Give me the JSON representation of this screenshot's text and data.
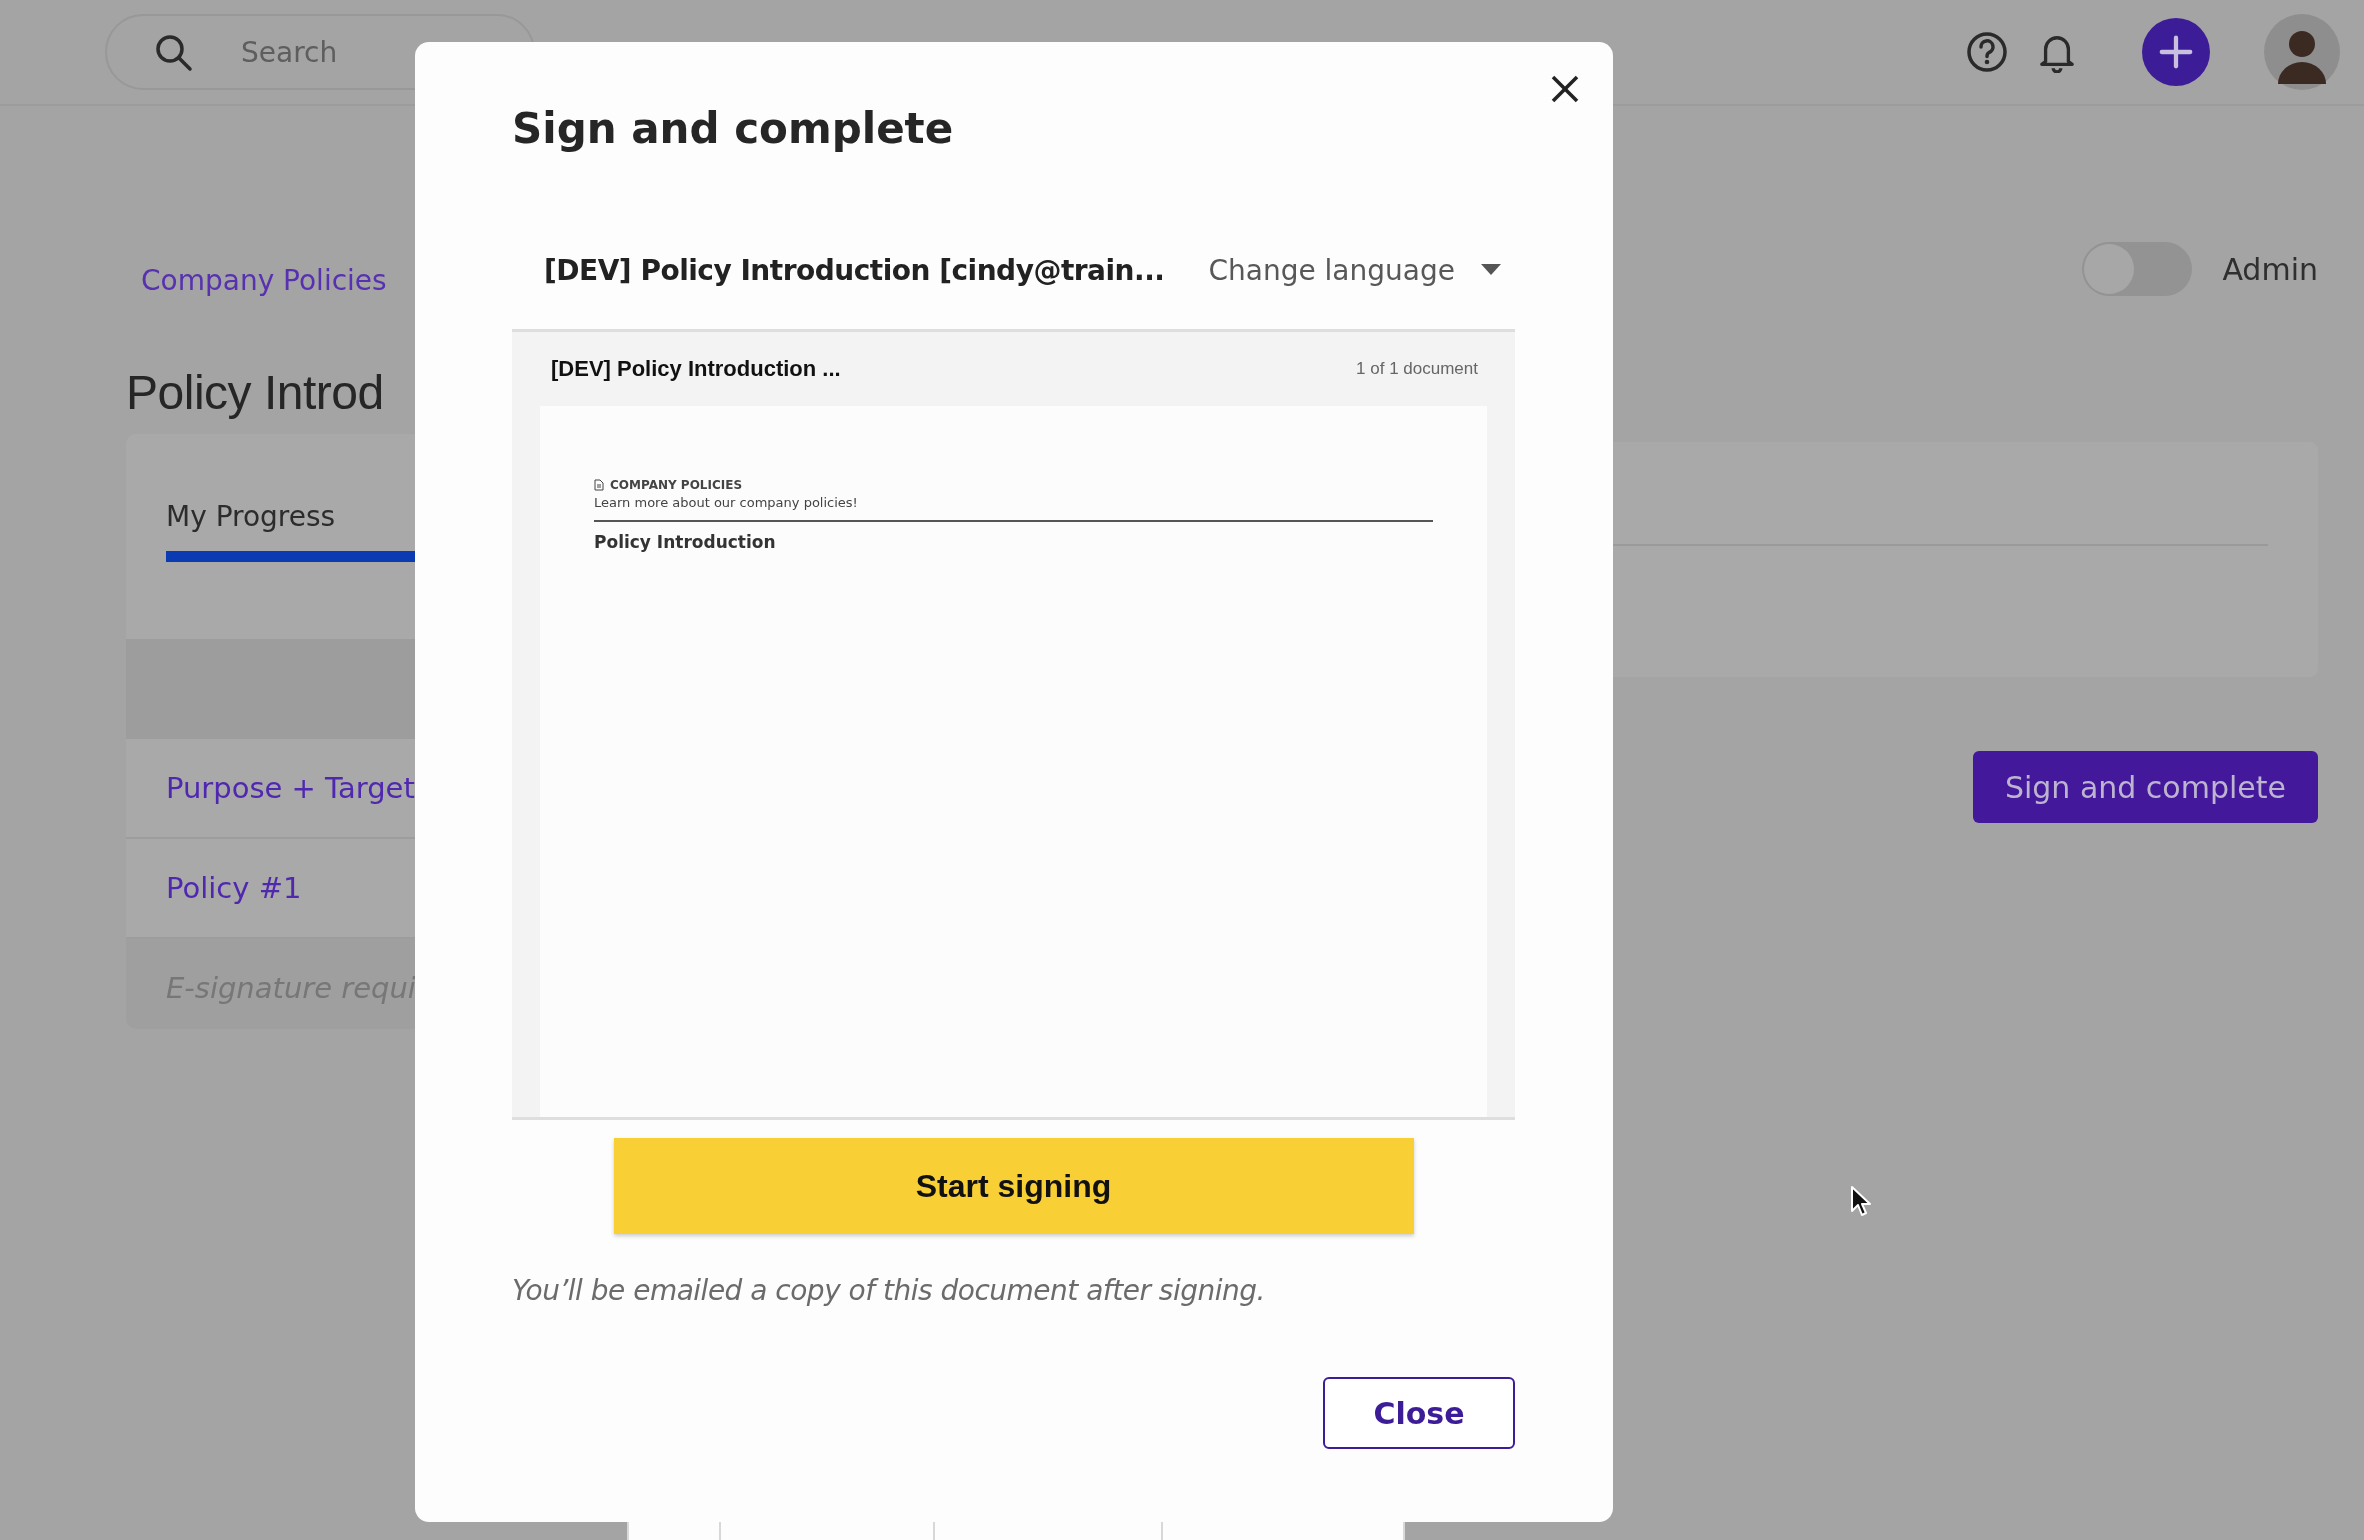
{
  "top_bar": {
    "search": {
      "placeholder": "Search"
    }
  },
  "background_page": {
    "breadcrumb": "Company Policies",
    "title": "Policy Introd",
    "tabs": [
      {
        "label": "My Progress",
        "selected": true
      }
    ],
    "sections": [
      {
        "label": "Purpose + Target",
        "kind": "link"
      },
      {
        "label": "Policy #1",
        "kind": "link"
      },
      {
        "label": "E-signature requi",
        "kind": "note"
      }
    ],
    "admin_toggle": {
      "label": "Admin",
      "on": false
    },
    "sign_button": "Sign and complete"
  },
  "modal": {
    "title": "Sign and complete",
    "document_name": "[DEV] Policy Introduction [cindy@train...",
    "language_menu": "Change language",
    "viewer": {
      "name": "[DEV] Policy Introduction ...",
      "count": "1 of 1 document",
      "page": {
        "section": "COMPANY POLICIES",
        "subtitle": "Learn more about our company policies!",
        "heading": "Policy Introduction"
      }
    },
    "primary_button": "Start signing",
    "note": "You’ll be emailed a copy of this document after signing.",
    "close_button": "Close"
  }
}
